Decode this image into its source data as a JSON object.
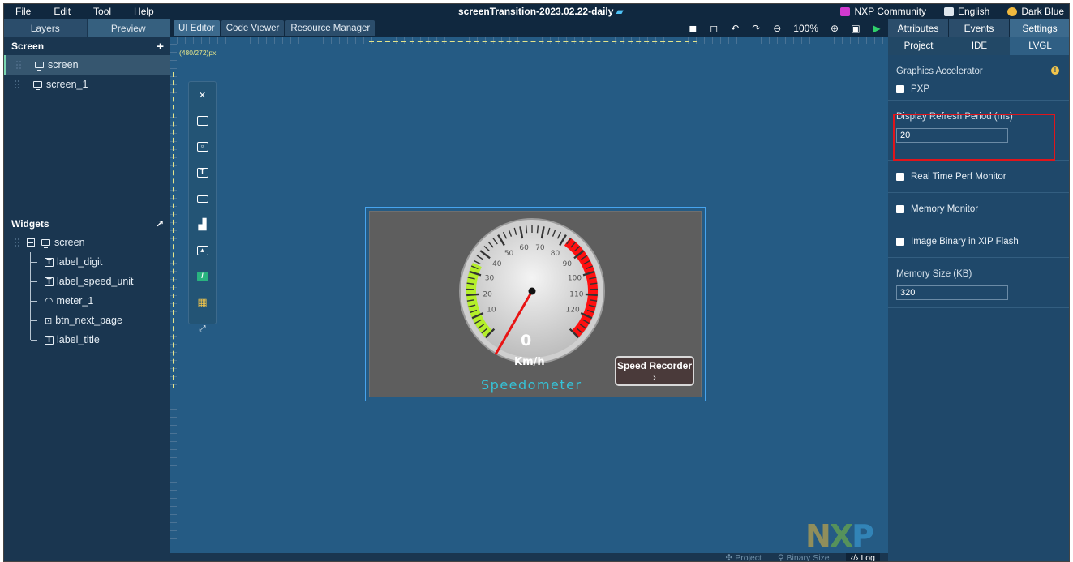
{
  "menu": {
    "items": [
      "File",
      "Edit",
      "Tool",
      "Help"
    ],
    "app_title": "screenTransition-2023.02.22-daily",
    "right": [
      "NXP Community",
      "English",
      "Dark Blue"
    ]
  },
  "left": {
    "tabs": [
      "Layers",
      "Preview"
    ],
    "screen_panel_title": "Screen",
    "screens": [
      "screen",
      "screen_1"
    ],
    "widgets_title": "Widgets",
    "widgets_root": "screen",
    "widgets": [
      "label_digit",
      "label_speed_unit",
      "meter_1",
      "btn_next_page",
      "label_title"
    ]
  },
  "center": {
    "tabs": [
      "UI Editor",
      "Code Viewer",
      "Resource Manager"
    ],
    "zoom": "100%",
    "canvas_size": "(480/272)px",
    "gauge": {
      "value": 0,
      "ticks": [
        "10",
        "20",
        "30",
        "40",
        "50",
        "60",
        "70",
        "80",
        "90",
        "100",
        "110",
        "120"
      ],
      "unit": "Km/h"
    },
    "title_label": "Speedometer",
    "button_line1": "Speed Recorder",
    "button_line2": "›",
    "status": [
      "Project",
      "Binary Size",
      "Log"
    ]
  },
  "right": {
    "tabs": [
      "Attributes",
      "Events",
      "Settings"
    ],
    "subtabs": [
      "Project",
      "IDE",
      "LVGL"
    ],
    "graphics_accelerator_label": "Graphics Accelerator",
    "pxp_label": "PXP",
    "refresh_label": "Display Refresh Period  (ms)",
    "refresh_value": "20",
    "perf_label": "Real Time Perf Monitor",
    "memory_monitor_label": "Memory Monitor",
    "image_binary_label": "Image Binary in XIP Flash",
    "memory_size_label": "Memory Size (KB)",
    "memory_size_value": "320"
  },
  "colors": {
    "highlight": "#e0151b",
    "accent_green": "#7ad6b2",
    "gauge_green": "#b4ef2a",
    "gauge_red": "#ff1010"
  }
}
